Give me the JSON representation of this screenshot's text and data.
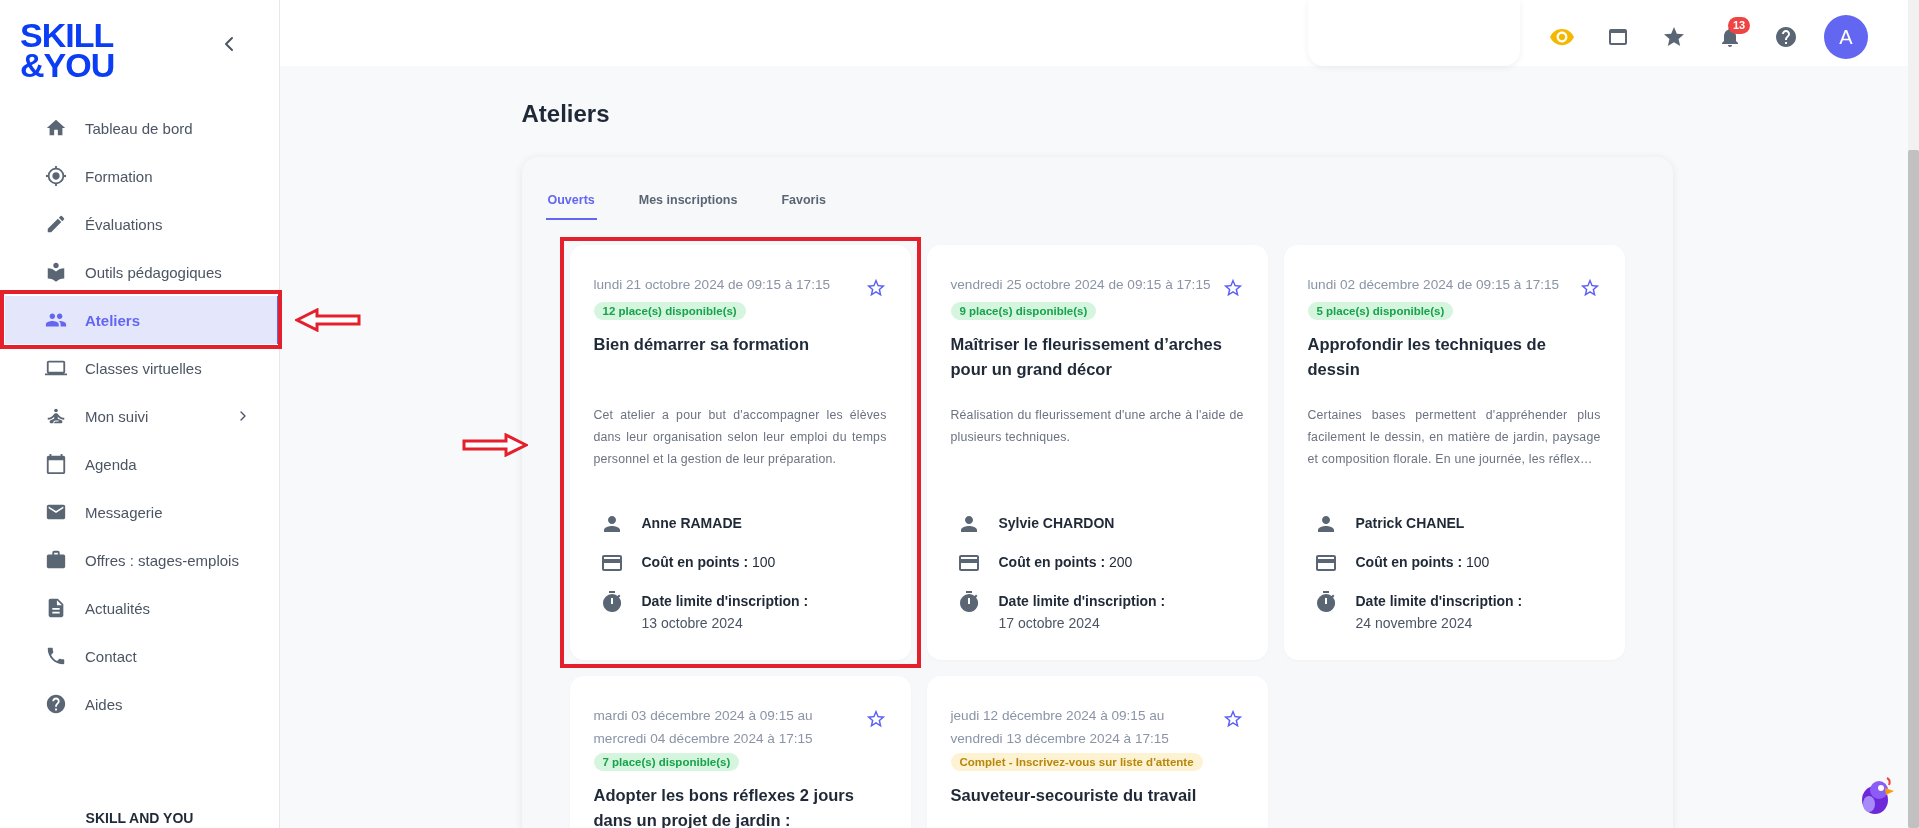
{
  "logo": {
    "line1": "SKILL",
    "line2": "&YOU"
  },
  "sidebar": {
    "items": [
      {
        "label": "Tableau de bord",
        "selected": false,
        "annotated": false,
        "has_submenu": false
      },
      {
        "label": "Formation",
        "selected": false,
        "annotated": false,
        "has_submenu": false
      },
      {
        "label": "Évaluations",
        "selected": false,
        "annotated": false,
        "has_submenu": false
      },
      {
        "label": "Outils pédagogiques",
        "selected": false,
        "annotated": false,
        "has_submenu": false
      },
      {
        "label": "Ateliers",
        "selected": true,
        "annotated": true,
        "has_submenu": false
      },
      {
        "label": "Classes virtuelles",
        "selected": false,
        "annotated": false,
        "has_submenu": false
      },
      {
        "label": "Mon suivi",
        "selected": false,
        "annotated": false,
        "has_submenu": true
      },
      {
        "label": "Agenda",
        "selected": false,
        "annotated": false,
        "has_submenu": false
      },
      {
        "label": "Messagerie",
        "selected": false,
        "annotated": false,
        "has_submenu": false
      },
      {
        "label": "Offres : stages-emplois",
        "selected": false,
        "annotated": false,
        "has_submenu": false
      },
      {
        "label": "Actualités",
        "selected": false,
        "annotated": false,
        "has_submenu": false
      },
      {
        "label": "Contact",
        "selected": false,
        "annotated": false,
        "has_submenu": false
      },
      {
        "label": "Aides",
        "selected": false,
        "annotated": false,
        "has_submenu": false
      }
    ],
    "footer": "SKILL AND YOU"
  },
  "header": {
    "notification_count": "13",
    "avatar_initial": "A"
  },
  "page_title": "Ateliers",
  "tabs": [
    {
      "label": "Ouverts",
      "selected": true
    },
    {
      "label": "Mes inscriptions",
      "selected": false
    },
    {
      "label": "Favoris",
      "selected": false
    }
  ],
  "workshops": [
    {
      "date": "lundi 21 octobre 2024 de 09:15 à 17:15",
      "availability": {
        "kind": "available",
        "text": "12 place(s) disponible(s)"
      },
      "title": "Bien démarrer sa formation",
      "description": "Cet atelier a pour but d'accompagner les élèves dans leur organisation selon leur emploi du temps personnel et la gestion de leur préparation.",
      "trainer": "Anne RAMADE",
      "cost_label": "Coût en points :",
      "cost": "100",
      "deadline_label": "Date limite d'inscription :",
      "deadline": "13 octobre 2024",
      "favorite": false,
      "annotated": true
    },
    {
      "date": "vendredi 25 octobre 2024 de 09:15 à 17:15",
      "availability": {
        "kind": "available",
        "text": "9 place(s) disponible(s)"
      },
      "title": "Maîtriser le fleurissement d’arches pour un grand décor",
      "description": "Réalisation du fleurissement d'une arche à l'aide de plusieurs techniques.",
      "trainer": "Sylvie CHARDON",
      "cost_label": "Coût en points :",
      "cost": "200",
      "deadline_label": "Date limite d'inscription :",
      "deadline": "17 octobre 2024",
      "favorite": false,
      "annotated": false
    },
    {
      "date": "lundi 02 décembre 2024 de 09:15 à 17:15",
      "availability": {
        "kind": "available",
        "text": "5 place(s) disponible(s)"
      },
      "title": "Approfondir les techniques de dessin",
      "description": "Certaines bases permettent d'appréhender plus facilement le dessin, en matière de jardin, paysage et composition florale. En une journée, les réflex…",
      "trainer": "Patrick CHANEL",
      "cost_label": "Coût en points :",
      "cost": "100",
      "deadline_label": "Date limite d'inscription :",
      "deadline": "24 novembre 2024",
      "favorite": false,
      "annotated": false
    },
    {
      "date": "mardi 03 décembre 2024 à 09:15 au mercredi 04 décembre 2024 à 17:15",
      "availability": {
        "kind": "available",
        "text": "7 place(s) disponible(s)"
      },
      "title": "Adopter les bons réflexes 2 jours dans un projet de jardin :",
      "favorite": false,
      "annotated": false
    },
    {
      "date": "jeudi 12 décembre 2024 à 09:15 au vendredi 13 décembre 2024 à 17:15",
      "availability": {
        "kind": "full",
        "text": "Complet - Inscrivez-vous sur liste d'attente"
      },
      "title": "Sauveteur-secouriste du travail",
      "favorite": false,
      "annotated": false
    }
  ]
}
